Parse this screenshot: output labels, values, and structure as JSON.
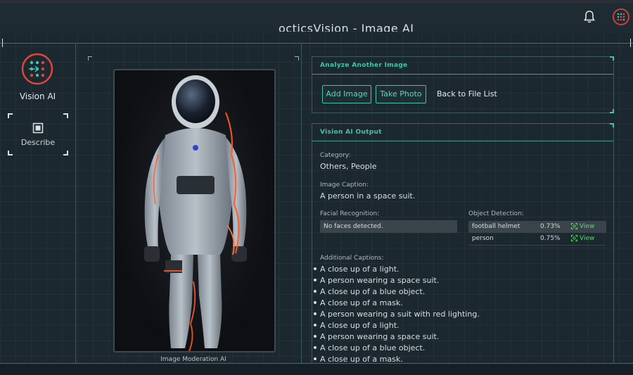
{
  "app": {
    "page_title": "octicsVision - Image AI"
  },
  "sidebar": {
    "brand_name": "Vision AI",
    "describe_label": "Describe"
  },
  "image_panel": {
    "caption": "Image Moderation AI"
  },
  "analyze_panel": {
    "header": "Analyze Another Image",
    "add_image_label": "Add Image",
    "take_photo_label": "Take Photo",
    "back_link": "Back to File List"
  },
  "output_panel": {
    "header": "Vision AI Output",
    "category_label": "Category:",
    "category_value": "Others, People",
    "caption_label": "Image Caption:",
    "caption_value": "A person in a space suit.",
    "facial_label": "Facial Recognition:",
    "facial_value": "No faces detected.",
    "object_label": "Object Detection:",
    "objects": [
      {
        "name": "football helmet",
        "confidence": "0.73%",
        "action": "View"
      },
      {
        "name": "person",
        "confidence": "0.75%",
        "action": "View"
      }
    ],
    "additional_label": "Additional Captions:",
    "additional_captions": [
      "A close up of a light.",
      "A person wearing a space suit.",
      "A close up of a blue object.",
      "A close up of a mask.",
      "A person wearing a suit with red lighting.",
      "A close up of a light.",
      "A person wearing a space suit.",
      "A close up of a blue object.",
      "A close up of a mask."
    ]
  },
  "colors": {
    "accent": "#44c3a8",
    "view_link": "#5bd96b",
    "background": "#1b2830"
  },
  "icons": {
    "topbar": [
      "bell-icon",
      "user-avatar-logo"
    ],
    "sidebar": [
      "vision-ai-logo",
      "describe-icon"
    ],
    "object_view": "view-icon"
  }
}
